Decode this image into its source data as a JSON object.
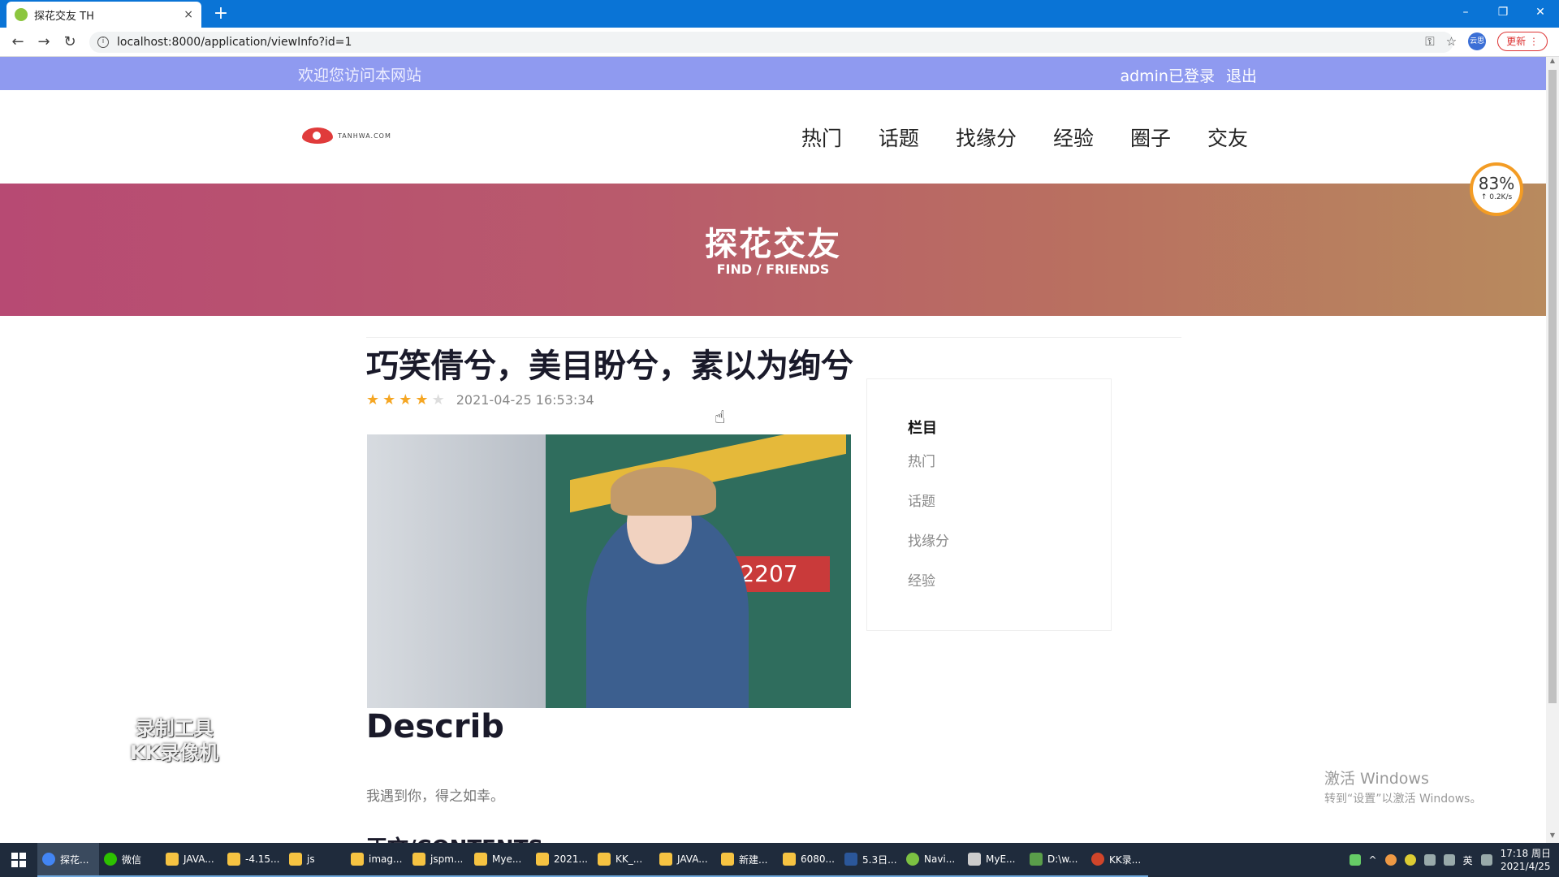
{
  "browser": {
    "tab_title": "探花交友 TH",
    "tab_close": "×",
    "new_tab": "+",
    "window_controls": [
      "–",
      "❐",
      "✕"
    ],
    "url": "localhost:8000/application/viewInfo?id=1",
    "profile_label": "云思",
    "update_label": "更新 ⋮",
    "nav": {
      "back": "←",
      "forward": "→",
      "reload": "↻"
    }
  },
  "site": {
    "welcome": "欢迎您访问本网站",
    "login_status": "admin已登录",
    "logout": "退出",
    "logo_text": "TANHWA.COM",
    "nav_items": [
      "热门",
      "话题",
      "找缘分",
      "经验",
      "圈子",
      "交友"
    ],
    "banner_title": "探花交友",
    "banner_sub": "FIND   /   FRIENDS"
  },
  "speed_widget": {
    "percent": "83%",
    "rate": "↑ 0.2K/s"
  },
  "article": {
    "title": "巧笑倩兮，美目盼兮，素以为绚兮",
    "rating": 4,
    "rating_max": 5,
    "date": "2021-04-25 16:53:34",
    "photo_plate": "2207",
    "describ_heading": "Describ",
    "description": "我遇到你，得之如幸。",
    "contents_heading": "正文/CONTENTS"
  },
  "sidebar": {
    "heading": "栏目",
    "items": [
      "热门",
      "话题",
      "找缘分",
      "经验"
    ]
  },
  "watermark": {
    "line1": "录制工具",
    "line2": "KK录像机"
  },
  "activate": {
    "line1": "激活 Windows",
    "line2": "转到“设置”以激活 Windows。"
  },
  "taskbar": {
    "items": [
      "探花...",
      "微信",
      "JAVA...",
      "-4.15...",
      "js",
      "imag...",
      "jspm...",
      "Mye...",
      "2021...",
      "KK_...",
      "JAVA...",
      "新建...",
      "6080...",
      "5.3日...",
      "Navi...",
      "MyE...",
      "D:\\w...",
      "KK录..."
    ],
    "ime": "英",
    "time": "17:18 周日",
    "date": "2021/4/25"
  },
  "colors": {
    "chrome_blue": "#0a74d6",
    "topbar": "#8f9af0",
    "banner_start": "#b74a73",
    "banner_end": "#b88a5e",
    "star": "#f5a623"
  }
}
